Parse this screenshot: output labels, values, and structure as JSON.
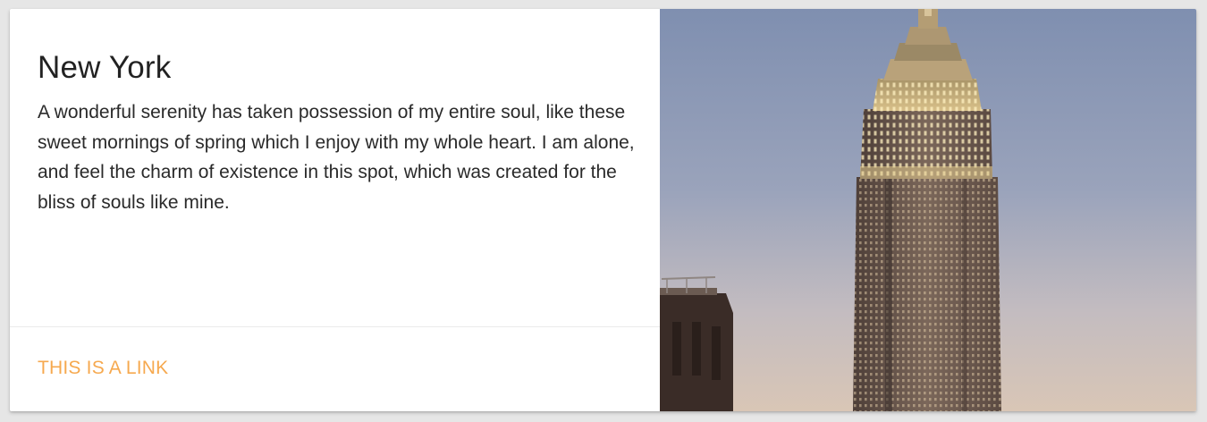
{
  "card": {
    "title": "New York",
    "body": "A wonderful serenity has taken possession of my entire soul, like these sweet mornings of spring which I enjoy with my whole heart. I am alone, and feel the charm of existence in this spot, which was created for the bliss of souls like mine.",
    "link_label": "THIS IS A LINK"
  },
  "colors": {
    "link": "#f6a94f",
    "sky_top": "#7f8fb0",
    "sky_bottom": "#d2c2b4"
  },
  "icons": {
    "photo": "skyscraper-photo"
  }
}
